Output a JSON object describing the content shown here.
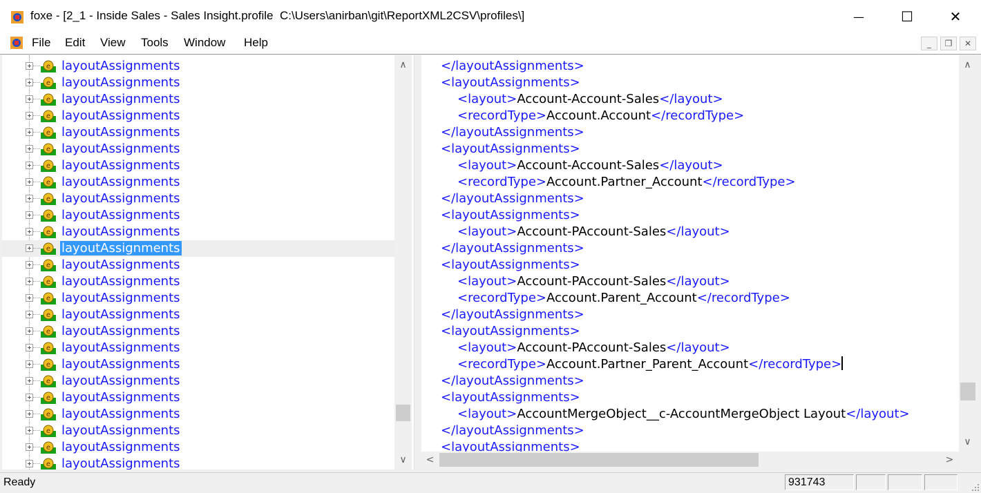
{
  "window": {
    "title": "foxe - [2_1 - Inside Sales - Sales Insight.profile  C:\\Users\\anirban\\git\\ReportXML2CSV\\profiles\\]",
    "minimize_glyph": "—",
    "maximize_glyph": "☐",
    "close_glyph": "✕"
  },
  "menu": {
    "items": [
      "File",
      "Edit",
      "View",
      "Tools",
      "Window",
      "Help"
    ]
  },
  "mdi_controls": {
    "minimize": "_",
    "restore": "❐",
    "close": "✕"
  },
  "tree": {
    "node_label": "layoutAssignments",
    "rows": [
      {
        "label": "layoutAssignments",
        "selected": false
      },
      {
        "label": "layoutAssignments",
        "selected": false
      },
      {
        "label": "layoutAssignments",
        "selected": false
      },
      {
        "label": "layoutAssignments",
        "selected": false
      },
      {
        "label": "layoutAssignments",
        "selected": false
      },
      {
        "label": "layoutAssignments",
        "selected": false
      },
      {
        "label": "layoutAssignments",
        "selected": false
      },
      {
        "label": "layoutAssignments",
        "selected": false
      },
      {
        "label": "layoutAssignments",
        "selected": false
      },
      {
        "label": "layoutAssignments",
        "selected": false
      },
      {
        "label": "layoutAssignments",
        "selected": false
      },
      {
        "label": "layoutAssignments",
        "selected": true
      },
      {
        "label": "layoutAssignments",
        "selected": false
      },
      {
        "label": "layoutAssignments",
        "selected": false
      },
      {
        "label": "layoutAssignments",
        "selected": false
      },
      {
        "label": "layoutAssignments",
        "selected": false
      },
      {
        "label": "layoutAssignments",
        "selected": false
      },
      {
        "label": "layoutAssignments",
        "selected": false
      },
      {
        "label": "layoutAssignments",
        "selected": false
      },
      {
        "label": "layoutAssignments",
        "selected": false
      },
      {
        "label": "layoutAssignments",
        "selected": false
      },
      {
        "label": "layoutAssignments",
        "selected": false
      },
      {
        "label": "layoutAssignments",
        "selected": false
      },
      {
        "label": "layoutAssignments",
        "selected": false
      },
      {
        "label": "layoutAssignments",
        "selected": false
      }
    ]
  },
  "xml": {
    "lines": [
      {
        "indent": 1,
        "parts": [
          {
            "t": "tag",
            "v": "</layoutAssignments>"
          }
        ]
      },
      {
        "indent": 1,
        "parts": [
          {
            "t": "tag",
            "v": "<layoutAssignments>"
          }
        ]
      },
      {
        "indent": 2,
        "parts": [
          {
            "t": "tag",
            "v": "<layout>"
          },
          {
            "t": "txt",
            "v": "Account-Account-Sales"
          },
          {
            "t": "tag",
            "v": "</layout>"
          }
        ]
      },
      {
        "indent": 2,
        "parts": [
          {
            "t": "tag",
            "v": "<recordType>"
          },
          {
            "t": "txt",
            "v": "Account.Account"
          },
          {
            "t": "tag",
            "v": "</recordType>"
          }
        ]
      },
      {
        "indent": 1,
        "parts": [
          {
            "t": "tag",
            "v": "</layoutAssignments>"
          }
        ]
      },
      {
        "indent": 1,
        "parts": [
          {
            "t": "tag",
            "v": "<layoutAssignments>"
          }
        ]
      },
      {
        "indent": 2,
        "parts": [
          {
            "t": "tag",
            "v": "<layout>"
          },
          {
            "t": "txt",
            "v": "Account-Account-Sales"
          },
          {
            "t": "tag",
            "v": "</layout>"
          }
        ]
      },
      {
        "indent": 2,
        "parts": [
          {
            "t": "tag",
            "v": "<recordType>"
          },
          {
            "t": "txt",
            "v": "Account.Partner_Account"
          },
          {
            "t": "tag",
            "v": "</recordType>"
          }
        ]
      },
      {
        "indent": 1,
        "parts": [
          {
            "t": "tag",
            "v": "</layoutAssignments>"
          }
        ]
      },
      {
        "indent": 1,
        "parts": [
          {
            "t": "tag",
            "v": "<layoutAssignments>"
          }
        ]
      },
      {
        "indent": 2,
        "parts": [
          {
            "t": "tag",
            "v": "<layout>"
          },
          {
            "t": "txt",
            "v": "Account-PAccount-Sales"
          },
          {
            "t": "tag",
            "v": "</layout>"
          }
        ]
      },
      {
        "indent": 1,
        "parts": [
          {
            "t": "tag",
            "v": "</layoutAssignments>"
          }
        ]
      },
      {
        "indent": 1,
        "parts": [
          {
            "t": "tag",
            "v": "<layoutAssignments>"
          }
        ]
      },
      {
        "indent": 2,
        "parts": [
          {
            "t": "tag",
            "v": "<layout>"
          },
          {
            "t": "txt",
            "v": "Account-PAccount-Sales"
          },
          {
            "t": "tag",
            "v": "</layout>"
          }
        ]
      },
      {
        "indent": 2,
        "parts": [
          {
            "t": "tag",
            "v": "<recordType>"
          },
          {
            "t": "txt",
            "v": "Account.Parent_Account"
          },
          {
            "t": "tag",
            "v": "</recordType>"
          }
        ]
      },
      {
        "indent": 1,
        "parts": [
          {
            "t": "tag",
            "v": "</layoutAssignments>"
          }
        ]
      },
      {
        "indent": 1,
        "parts": [
          {
            "t": "tag",
            "v": "<layoutAssignments>"
          }
        ]
      },
      {
        "indent": 2,
        "parts": [
          {
            "t": "tag",
            "v": "<layout>"
          },
          {
            "t": "txt",
            "v": "Account-PAccount-Sales"
          },
          {
            "t": "tag",
            "v": "</layout>"
          }
        ]
      },
      {
        "indent": 2,
        "caret": true,
        "parts": [
          {
            "t": "tag",
            "v": "<recordType>"
          },
          {
            "t": "txt",
            "v": "Account.Partner_Parent_Account"
          },
          {
            "t": "tag",
            "v": "</recordType>"
          }
        ]
      },
      {
        "indent": 1,
        "parts": [
          {
            "t": "tag",
            "v": "</layoutAssignments>"
          }
        ]
      },
      {
        "indent": 1,
        "parts": [
          {
            "t": "tag",
            "v": "<layoutAssignments>"
          }
        ]
      },
      {
        "indent": 2,
        "parts": [
          {
            "t": "tag",
            "v": "<layout>"
          },
          {
            "t": "txt",
            "v": "AccountMergeObject__c-AccountMergeObject Layout"
          },
          {
            "t": "tag",
            "v": "</layout>"
          }
        ]
      },
      {
        "indent": 1,
        "parts": [
          {
            "t": "tag",
            "v": "</layoutAssignments>"
          }
        ]
      },
      {
        "indent": 1,
        "parts": [
          {
            "t": "tag",
            "v": "<layoutAssignments>"
          }
        ]
      }
    ]
  },
  "status": {
    "text": "Ready",
    "position": "931743"
  },
  "colors": {
    "tag": "#1a1aff",
    "text": "#000000",
    "selection": "#3399ff"
  }
}
